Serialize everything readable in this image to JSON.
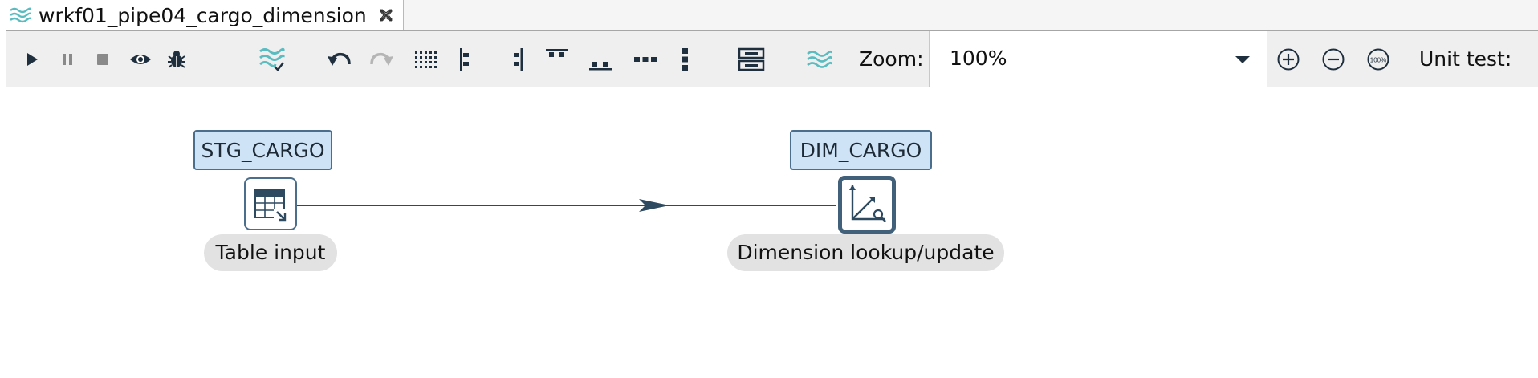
{
  "tab": {
    "title": "wrkf01_pipe04_cargo_dimension",
    "icon": "pipeline-icon",
    "close_icon": "close-icon"
  },
  "toolbar": {
    "buttons": [
      {
        "name": "run-button",
        "icon": "play-icon"
      },
      {
        "name": "pause-button",
        "icon": "pause-icon"
      },
      {
        "name": "stop-button",
        "icon": "stop-icon"
      },
      {
        "name": "preview-button",
        "icon": "eye-icon"
      },
      {
        "name": "debug-button",
        "icon": "bug-icon"
      },
      {
        "name": "check-pipeline-button",
        "icon": "check-pipeline-icon"
      },
      {
        "name": "undo-button",
        "icon": "undo-icon"
      },
      {
        "name": "redo-button",
        "icon": "redo-icon"
      },
      {
        "name": "snap-to-grid-button",
        "icon": "grid-icon"
      },
      {
        "name": "align-left-button",
        "icon": "align-left-icon"
      },
      {
        "name": "align-right-button",
        "icon": "align-right-icon"
      },
      {
        "name": "align-top-button",
        "icon": "align-top-icon"
      },
      {
        "name": "align-bottom-button",
        "icon": "align-bottom-icon"
      },
      {
        "name": "distribute-horizontally-button",
        "icon": "distribute-horizontal-icon"
      },
      {
        "name": "distribute-vertically-button",
        "icon": "distribute-vertical-icon"
      },
      {
        "name": "edit-properties-button",
        "icon": "properties-icon"
      },
      {
        "name": "pipeline-settings-button",
        "icon": "pipeline-icon"
      }
    ],
    "zoom_label": "Zoom:",
    "zoom_value": "100%",
    "zoom_in_icon": "zoom-in-icon",
    "zoom_out_icon": "zoom-out-icon",
    "zoom_reset_icon": "zoom-100-icon",
    "zoom_reset_text": "100%",
    "unit_test_label": "Unit test:"
  },
  "canvas": {
    "steps": [
      {
        "name": "STG_CARGO",
        "type": "Table input",
        "icon": "table-input-icon"
      },
      {
        "name": "DIM_CARGO",
        "type": "Dimension lookup/update",
        "icon": "dimension-lookup-icon",
        "selected": true
      }
    ],
    "hops": [
      {
        "from": "STG_CARGO",
        "to": "DIM_CARGO"
      }
    ]
  },
  "colors": {
    "accent": "#5bbcc0",
    "step_name_bg": "#cfe3f7",
    "step_border": "#4a6e8c",
    "hop_line": "#2e4a60",
    "label_bg": "#e2e2e2"
  }
}
